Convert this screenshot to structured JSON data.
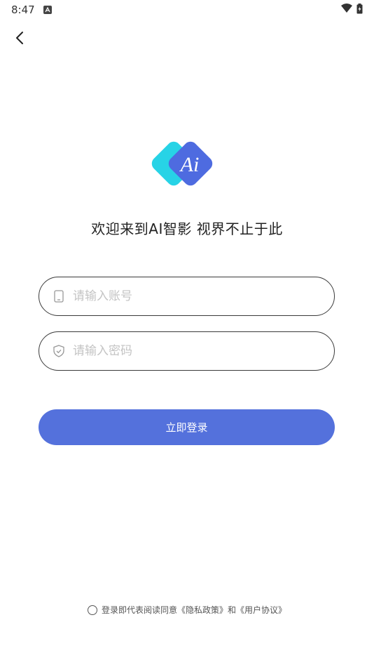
{
  "status_bar": {
    "time": "8:47"
  },
  "welcome_text": "欢迎来到AI智影 视界不止于此",
  "account_field": {
    "placeholder": "请输入账号"
  },
  "password_field": {
    "placeholder": "请输入密码"
  },
  "login_button": {
    "label": "立即登录"
  },
  "agreement": {
    "prefix": "登录即代表阅读同意",
    "privacy_link": "《隐私政策》",
    "conjunction": "和",
    "user_link": "《用户协议》"
  },
  "logo": {
    "text": "Ai"
  },
  "colors": {
    "primary": "#5471dc",
    "logo_cyan": "#27d3e6",
    "logo_blue": "#4e6be0"
  }
}
